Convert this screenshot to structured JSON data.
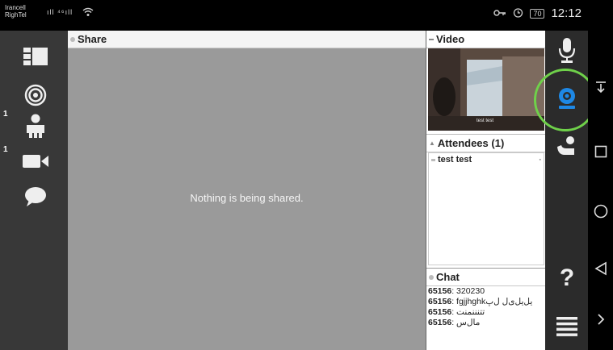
{
  "status_bar": {
    "carrier_1": "Irancell",
    "carrier_2": "RighTel",
    "signal": "ıll ⁴⁶ıll",
    "battery": "70",
    "time": "12:12"
  },
  "share": {
    "title": "Share",
    "empty_message": "Nothing is being shared."
  },
  "video": {
    "title": "Video",
    "caption": "test test"
  },
  "attendees": {
    "title": "Attendees (1)",
    "items": [
      {
        "name": "test test"
      }
    ]
  },
  "chat": {
    "title": "Chat",
    "messages": [
      {
        "user": "65156",
        "text": ": 320230"
      },
      {
        "user": "65156",
        "text": ": fgjjhghkیل‌یل‌ی‌ل ل‌پ"
      },
      {
        "user": "65156",
        "text": ": تتنننمنت"
      },
      {
        "user": "65156",
        "text": ": مال‌س"
      }
    ]
  },
  "left_badges": {
    "attendees_count": "1",
    "camera_count": "1"
  },
  "icons": {
    "layout": "layout-icon",
    "target": "target-icon",
    "attendee": "attendee-icon",
    "camera": "camera-icon",
    "chat": "chat-bubble-icon",
    "mic": "microphone-icon",
    "webcam": "webcam-icon",
    "raise_hand": "raise-hand-icon",
    "help": "help-icon",
    "menu": "menu-icon"
  },
  "colors": {
    "webcam_active": "#1e88e5",
    "highlight_circle": "#6fd14a",
    "share_bg": "#9a9a9a"
  },
  "help_glyph": "?"
}
